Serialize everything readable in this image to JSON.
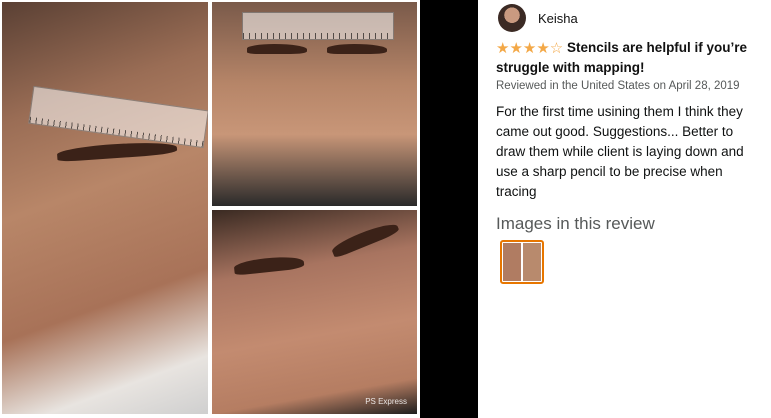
{
  "reviewer": {
    "name": "Keisha",
    "avatar_icon": "user-avatar-icon"
  },
  "rating": {
    "stars_filled": 4,
    "stars_total": 5,
    "color": "#f3a847"
  },
  "review": {
    "title": "Stencils are helpful if you’re struggle with mapping!",
    "meta": "Reviewed in the United States on April 28, 2019",
    "body": "For the first time usining them I think they came out good. Suggestions... Better to draw them while client is laying down and use a sharp pencil to be precise when tracing"
  },
  "images_section": {
    "heading": "Images in this review",
    "thumbnail_border": "#e77600"
  },
  "collage": {
    "watermark": "PS Express"
  }
}
